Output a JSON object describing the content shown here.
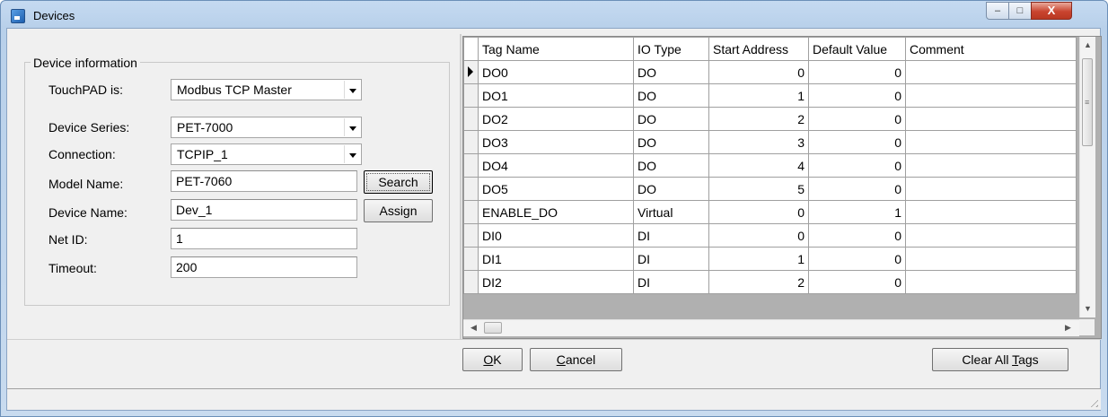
{
  "window": {
    "title": "Devices",
    "close_glyph": "X",
    "accent": "#c5daf1"
  },
  "device_info": {
    "group_title": "Device information",
    "touchpad_label": "TouchPAD is:",
    "touchpad_value": "Modbus TCP Master",
    "series_label": "Device Series:",
    "series_value": "PET-7000",
    "connection_label": "Connection:",
    "connection_value": "TCPIP_1",
    "model_label": "Model Name:",
    "model_value": "PET-7060",
    "device_name_label": "Device Name:",
    "device_name_value": "Dev_1",
    "net_id_label": "Net ID:",
    "net_id_value": "1",
    "timeout_label": "Timeout:",
    "timeout_value": "200",
    "search_label": "Search",
    "assign_label": "Assign"
  },
  "grid": {
    "columns": [
      "Tag Name",
      "IO Type",
      "Start Address",
      "Default Value",
      "Comment"
    ],
    "rows": [
      {
        "tag": "DO0",
        "io": "DO",
        "start": "0",
        "default": "0",
        "comment": ""
      },
      {
        "tag": "DO1",
        "io": "DO",
        "start": "1",
        "default": "0",
        "comment": ""
      },
      {
        "tag": "DO2",
        "io": "DO",
        "start": "2",
        "default": "0",
        "comment": ""
      },
      {
        "tag": "DO3",
        "io": "DO",
        "start": "3",
        "default": "0",
        "comment": ""
      },
      {
        "tag": "DO4",
        "io": "DO",
        "start": "4",
        "default": "0",
        "comment": ""
      },
      {
        "tag": "DO5",
        "io": "DO",
        "start": "5",
        "default": "0",
        "comment": ""
      },
      {
        "tag": "ENABLE_DO",
        "io": "Virtual",
        "start": "0",
        "default": "1",
        "comment": ""
      },
      {
        "tag": "DI0",
        "io": "DI",
        "start": "0",
        "default": "0",
        "comment": ""
      },
      {
        "tag": "DI1",
        "io": "DI",
        "start": "1",
        "default": "0",
        "comment": ""
      },
      {
        "tag": "DI2",
        "io": "DI",
        "start": "2",
        "default": "0",
        "comment": ""
      }
    ],
    "selected_row": 0
  },
  "buttons": {
    "ok_mnemonic": "O",
    "ok_rest": "K",
    "cancel_mnemonic": "C",
    "cancel_rest": "ancel",
    "clear_prefix": "Clear All ",
    "clear_mnemonic": "T",
    "clear_rest": "ags"
  },
  "icons": [
    "app-icon",
    "minimize-icon",
    "maximize-icon",
    "close-icon",
    "dropdown-arrow-icon",
    "row-pointer-icon",
    "scroll-up-icon",
    "scroll-down-icon",
    "scroll-left-icon",
    "scroll-right-icon",
    "size-grip-icon"
  ]
}
